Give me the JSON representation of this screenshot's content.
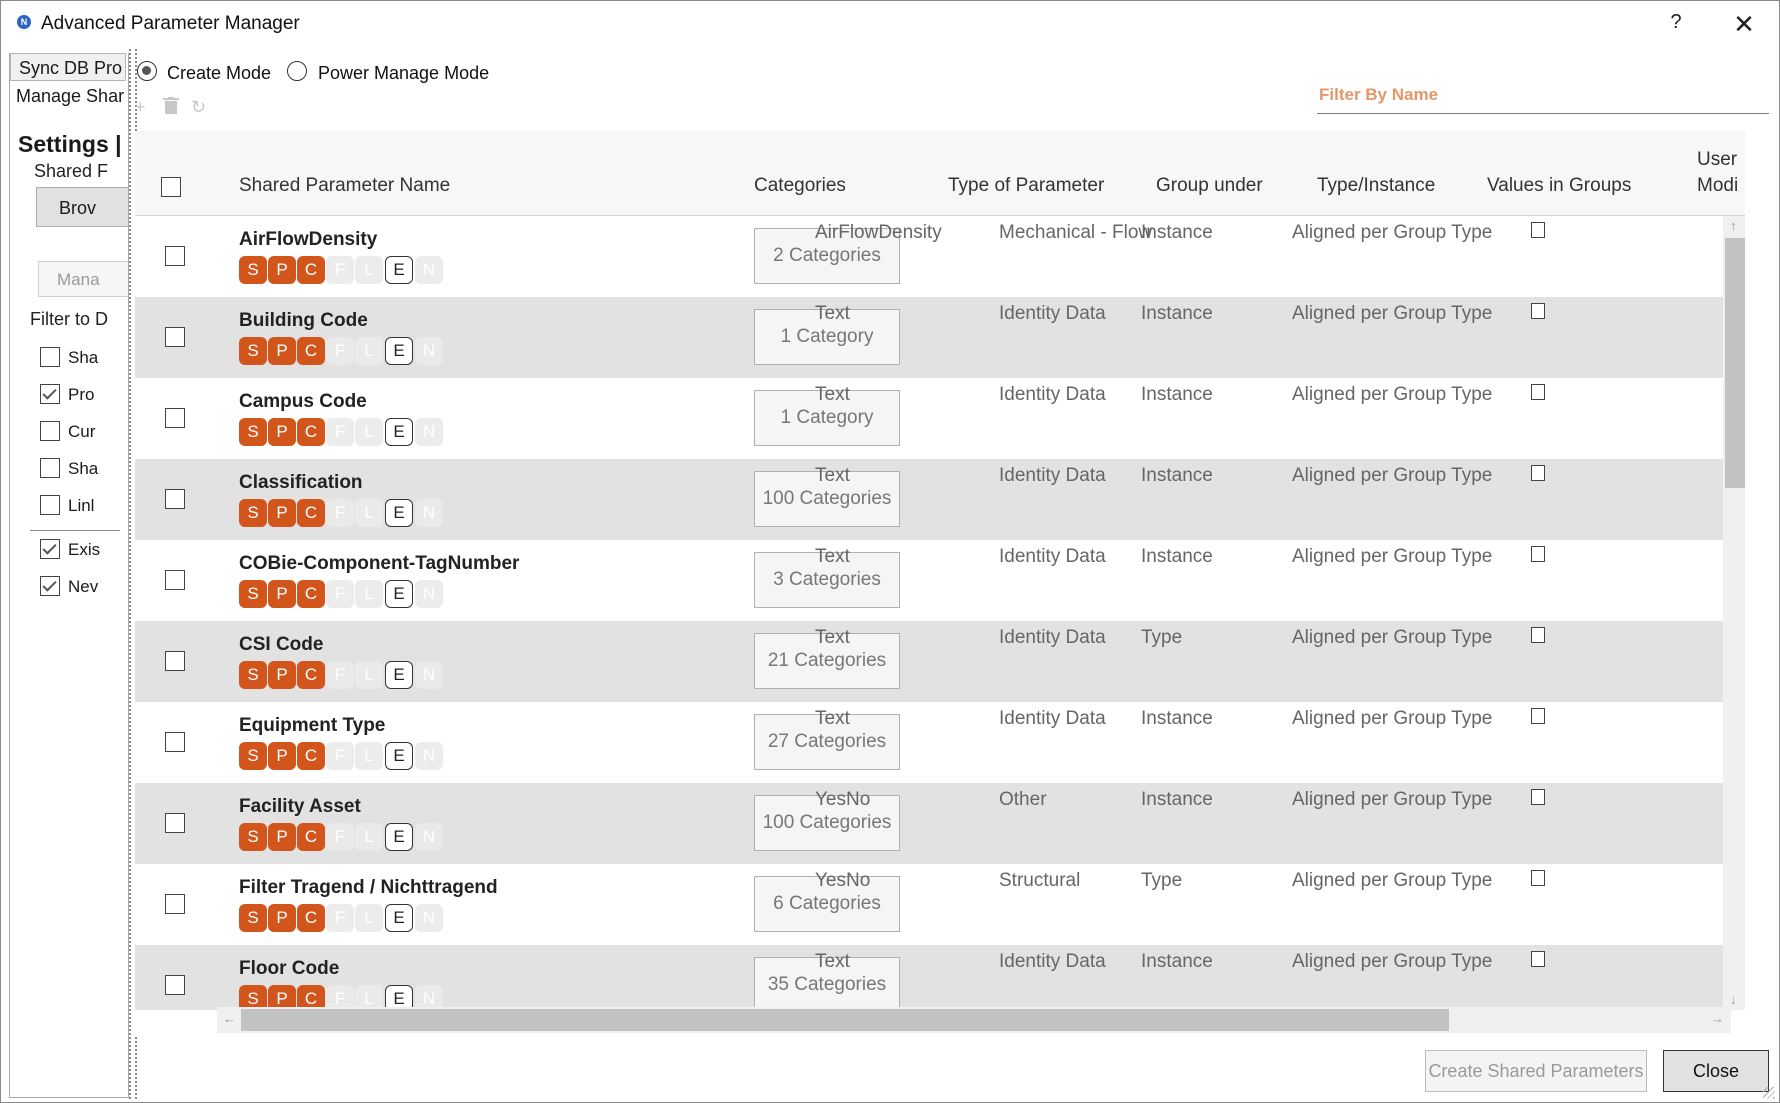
{
  "window": {
    "title": "Advanced Parameter Manager",
    "help_label": "?",
    "close_label": "✕",
    "app_icon": "N"
  },
  "left_panel": {
    "tab_sync": "Sync DB Pro",
    "tab_manage": "Manage Shar",
    "settings_title": "Settings |",
    "shared_label": "Shared F",
    "browse_label": "Brov",
    "manage_label": "Mana",
    "filter_label": "Filter to D",
    "checks": [
      {
        "label": "Sha",
        "checked": false
      },
      {
        "label": "Pro",
        "checked": true
      },
      {
        "label": "Cur",
        "checked": false
      },
      {
        "label": "Sha",
        "checked": false
      },
      {
        "label": "Linl",
        "checked": false
      },
      {
        "label": "Exis",
        "checked": true
      },
      {
        "label": "Nev",
        "checked": true
      }
    ]
  },
  "modes": {
    "create": "Create Mode",
    "power": "Power Manage Mode",
    "selected": "create"
  },
  "toolbar": {
    "add_icon": "plus-icon",
    "delete_icon": "trash-icon",
    "refresh_icon": "refresh-icon"
  },
  "filter": {
    "placeholder": "Filter By Name"
  },
  "grid": {
    "headers": {
      "name": "Shared Parameter Name",
      "categories": "Categories",
      "type": "Type of Parameter",
      "group": "Group under",
      "type_instance": "Type/Instance",
      "values": "Values in Groups",
      "user_mod_1": "User",
      "user_mod_2": "Modi"
    },
    "badge_letters": [
      "S",
      "P",
      "C",
      "F",
      "L",
      "E",
      "N"
    ],
    "rows": [
      {
        "name": "AirFlowDensity",
        "categories": "2 Categories",
        "type": "AirFlowDensity",
        "group": "Mechanical - Flow",
        "type_instance": "Instance",
        "values": "Aligned per Group Type"
      },
      {
        "name": "Building Code",
        "categories": "1 Category",
        "type": "Text",
        "group": "Identity Data",
        "type_instance": "Instance",
        "values": "Aligned per Group Type"
      },
      {
        "name": "Campus Code",
        "categories": "1 Category",
        "type": "Text",
        "group": "Identity Data",
        "type_instance": "Instance",
        "values": "Aligned per Group Type"
      },
      {
        "name": "Classification",
        "categories": "100 Categories",
        "type": "Text",
        "group": "Identity Data",
        "type_instance": "Instance",
        "values": "Aligned per Group Type"
      },
      {
        "name": "COBie-Component-TagNumber",
        "categories": "3 Categories",
        "type": "Text",
        "group": "Identity Data",
        "type_instance": "Instance",
        "values": "Aligned per Group Type"
      },
      {
        "name": "CSI Code",
        "categories": "21 Categories",
        "type": "Text",
        "group": "Identity Data",
        "type_instance": "Type",
        "values": "Aligned per Group Type"
      },
      {
        "name": "Equipment Type",
        "categories": "27 Categories",
        "type": "Text",
        "group": "Identity Data",
        "type_instance": "Instance",
        "values": "Aligned per Group Type"
      },
      {
        "name": "Facility Asset",
        "categories": "100 Categories",
        "type": "YesNo",
        "group": "Other",
        "type_instance": "Instance",
        "values": "Aligned per Group Type"
      },
      {
        "name": "Filter Tragend / Nichttragend",
        "categories": "6 Categories",
        "type": "YesNo",
        "group": "Structural",
        "type_instance": "Type",
        "values": "Aligned per Group Type"
      },
      {
        "name": "Floor Code",
        "categories": "35 Categories",
        "type": "Text",
        "group": "Identity Data",
        "type_instance": "Instance",
        "values": "Aligned per Group Type"
      }
    ]
  },
  "footer": {
    "create_label": "Create Shared Parameters",
    "close_label": "Close"
  },
  "colors": {
    "badge_on": "#d2551c",
    "filter_placeholder": "#e3986a",
    "alt_row": "#e2e2e2"
  }
}
